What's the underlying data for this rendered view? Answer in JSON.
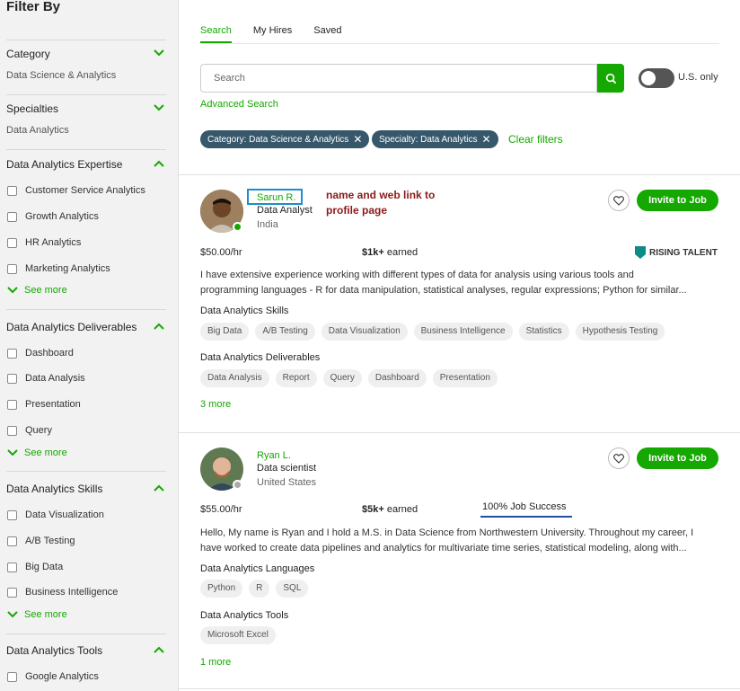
{
  "sidebar": {
    "title": "Filter By",
    "category": {
      "label": "Category",
      "value": "Data Science & Analytics"
    },
    "specialties": {
      "label": "Specialties",
      "value": "Data Analytics"
    },
    "expertise": {
      "label": "Data Analytics Expertise",
      "options": [
        "Customer Service Analytics",
        "Growth Analytics",
        "HR Analytics",
        "Marketing Analytics"
      ],
      "see_more": "See more"
    },
    "deliverables": {
      "label": "Data Analytics Deliverables",
      "options": [
        "Dashboard",
        "Data Analysis",
        "Presentation",
        "Query"
      ],
      "see_more": "See more"
    },
    "skills": {
      "label": "Data Analytics Skills",
      "options": [
        "Data Visualization",
        "A/B Testing",
        "Big Data",
        "Business Intelligence"
      ],
      "see_more": "See more"
    },
    "tools": {
      "label": "Data Analytics Tools",
      "options": [
        "Google Analytics"
      ]
    }
  },
  "tabs": [
    "Search",
    "My Hires",
    "Saved"
  ],
  "search": {
    "placeholder": "Search",
    "us_only": "U.S. only",
    "advanced": "Advanced Search"
  },
  "active_filters": [
    "Category: Data Science & Analytics",
    "Specialty: Data Analytics"
  ],
  "clear_filters": "Clear filters",
  "annotation": [
    "name and web link to",
    "profile page"
  ],
  "freelancers": [
    {
      "name": "Sarun R.",
      "title": "Data Analyst",
      "country": "India",
      "rate": "$50.00/hr",
      "earned_amount": "$1k+",
      "earned_label": "earned",
      "badge": "RISING TALENT",
      "invite": "Invite to Job",
      "description": [
        "I have extensive experience working with different types of data for analysis using various tools and",
        "programming languages - R for data manipulation, statistical analyses, regular expressions; Python for similar..."
      ],
      "group1_title": "Data Analytics Skills",
      "group1": [
        "Big Data",
        "A/B Testing",
        "Data Visualization",
        "Business Intelligence",
        "Statistics",
        "Hypothesis Testing"
      ],
      "group2_title": "Data Analytics Deliverables",
      "group2": [
        "Data Analysis",
        "Report",
        "Query",
        "Dashboard",
        "Presentation"
      ],
      "more": "3 more",
      "online": true
    },
    {
      "name": "Ryan L.",
      "title": "Data scientist",
      "country": "United States",
      "rate": "$55.00/hr",
      "earned_amount": "$5k+",
      "earned_label": "earned",
      "job_success": "100% Job Success",
      "invite": "Invite to Job",
      "description": [
        "Hello, My name is Ryan and I hold a M.S. in Data Science from Northwestern University. Throughout my career, I",
        "have worked to create data pipelines and analytics for multivariate time series, statistical modeling, along with..."
      ],
      "group1_title": "Data Analytics Languages",
      "group1": [
        "Python",
        "R",
        "SQL"
      ],
      "group2_title": "Data Analytics Tools",
      "group2": [
        "Microsoft Excel"
      ],
      "more": "1 more",
      "online": false
    }
  ],
  "colors": {
    "accent": "#14a800",
    "chip": "#37576b",
    "annotation": "#8b1a1a",
    "highlight_box": "#1a8fd0"
  }
}
